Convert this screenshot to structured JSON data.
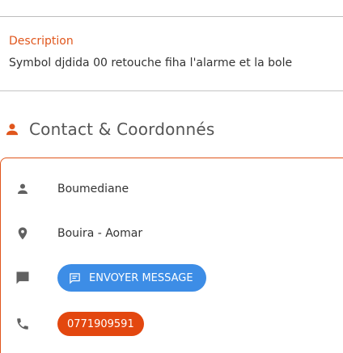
{
  "description": {
    "label": "Description",
    "text": "Symbol djdida 00 retouche fiha l'alarme et la bole"
  },
  "contact_section": {
    "title": "Contact & Coordonnés",
    "icon": "person-icon",
    "name": "Boumediane",
    "location": "Bouira - Aomar",
    "message_button_label": "ENVOYER MESSAGE",
    "phone": "0771909591"
  },
  "colors": {
    "accent": "#e0561c",
    "message_button": "#3d8de6",
    "phone_button": "#e3470f",
    "icon_gray": "#616161"
  }
}
